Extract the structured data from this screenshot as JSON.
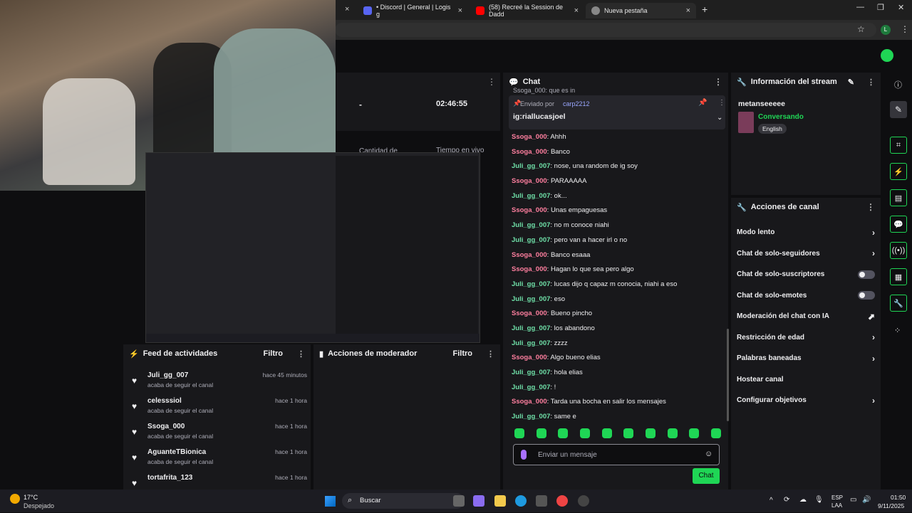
{
  "browser": {
    "tabs": [
      {
        "label": "• Discord | General | Logis g",
        "fav_color": "#5865f2"
      },
      {
        "label": "(58) Recreé la Session de Dadd",
        "fav_color": "#ff0000"
      },
      {
        "label": "Nueva pestaña",
        "fav_color": "#888888"
      }
    ],
    "new_tab": "+",
    "close_glyph": "×",
    "profile_letter": "L"
  },
  "stats": {
    "subs_value": "-",
    "subs_label": "Cantidad de suscripciones",
    "uptime_value": "02:46:55",
    "uptime_label": "Tiempo en vivo"
  },
  "chat": {
    "title": "Chat",
    "pinned": {
      "sent_by_label": "Enviado por",
      "sent_by_user": "carp2212",
      "message": "ig:riallucasjoel",
      "prev_line": "Ssoga_000: que es in"
    },
    "messages": [
      {
        "user": "Ssoga_000",
        "text": "Ahhh",
        "color": "u1"
      },
      {
        "user": "Ssoga_000",
        "text": "Banco",
        "color": "u1"
      },
      {
        "user": "Juli_gg_007",
        "text": "nose, una random de ig soy",
        "color": "u2"
      },
      {
        "user": "Ssoga_000",
        "text": "PARAAAAA",
        "color": "u1"
      },
      {
        "user": "Juli_gg_007",
        "text": "ok...",
        "color": "u2"
      },
      {
        "user": "Ssoga_000",
        "text": "Unas empaguesas",
        "color": "u1"
      },
      {
        "user": "Juli_gg_007",
        "text": "no m conoce niahi",
        "color": "u2"
      },
      {
        "user": "Juli_gg_007",
        "text": "pero van a hacer irl o no",
        "color": "u2"
      },
      {
        "user": "Ssoga_000",
        "text": "Banco esaaa",
        "color": "u1"
      },
      {
        "user": "Ssoga_000",
        "text": "Hagan lo que sea pero algo",
        "color": "u1"
      },
      {
        "user": "Juli_gg_007",
        "text": "lucas dijo q capaz m conocia, niahi a eso",
        "color": "u2"
      },
      {
        "user": "Juli_gg_007",
        "text": "eso",
        "color": "u2"
      },
      {
        "user": "Ssoga_000",
        "text": "Bueno pincho",
        "color": "u1"
      },
      {
        "user": "Juli_gg_007",
        "text": "los abandono",
        "color": "u2"
      },
      {
        "user": "Juli_gg_007",
        "text": "zzzz",
        "color": "u2"
      },
      {
        "user": "Ssoga_000",
        "text": "Algo bueno elias",
        "color": "u1"
      },
      {
        "user": "Juli_gg_007",
        "text": "hola elias",
        "color": "u2"
      },
      {
        "user": "Juli_gg_007",
        "text": "!",
        "color": "u2"
      },
      {
        "user": "Ssoga_000",
        "text": "Tarda una bocha en salir los mensajes",
        "color": "u1"
      },
      {
        "user": "Juli_gg_007",
        "text": "same e",
        "color": "u2"
      }
    ],
    "input_placeholder": "Enviar un mensaje",
    "send_label": "Chat"
  },
  "stream_info": {
    "title": "Información del stream",
    "stream_title": "metanseeeee",
    "category": "Conversando",
    "tag": "English"
  },
  "channel_actions": {
    "title": "Acciones de canal",
    "items": [
      {
        "label": "Modo lento",
        "kind": "chevron"
      },
      {
        "label": "Chat de solo-seguidores",
        "kind": "chevron"
      },
      {
        "label": "Chat de solo-suscriptores",
        "kind": "toggle"
      },
      {
        "label": "Chat de solo-emotes",
        "kind": "toggle"
      },
      {
        "label": "Moderación del chat con IA",
        "kind": "chart"
      },
      {
        "label": "Restricción de edad",
        "kind": "chevron"
      },
      {
        "label": "Palabras baneadas",
        "kind": "chevron"
      },
      {
        "label": "Hostear canal",
        "kind": "none"
      },
      {
        "label": "Configurar objetivos",
        "kind": "chevron"
      }
    ]
  },
  "feed": {
    "title": "Feed de actividades",
    "filter": "Filtro",
    "items": [
      {
        "name": "Juli_gg_007",
        "sub": "acaba de seguir el canal",
        "time": "hace 45 minutos"
      },
      {
        "name": "celesssiol",
        "sub": "acaba de seguir el canal",
        "time": "hace 1 hora"
      },
      {
        "name": "Ssoga_000",
        "sub": "acaba de seguir el canal",
        "time": "hace 1 hora"
      },
      {
        "name": "AguanteTBionica",
        "sub": "acaba de seguir el canal",
        "time": "hace 1 hora"
      },
      {
        "name": "tortafrita_123",
        "sub": "",
        "time": "hace 1 hora"
      }
    ]
  },
  "mod_actions": {
    "title": "Acciones de moderador",
    "filter": "Filtro"
  },
  "taskbar": {
    "weather_temp": "17°C",
    "weather_desc": "Despejado",
    "search_placeholder": "Buscar",
    "lang1": "ESP",
    "lang2": "LAA",
    "time": "01:50",
    "date": "9/11/2025"
  },
  "colors": {
    "accent_green": "#1fd655",
    "bg": "#0e0e10",
    "panel": "#18181b"
  }
}
